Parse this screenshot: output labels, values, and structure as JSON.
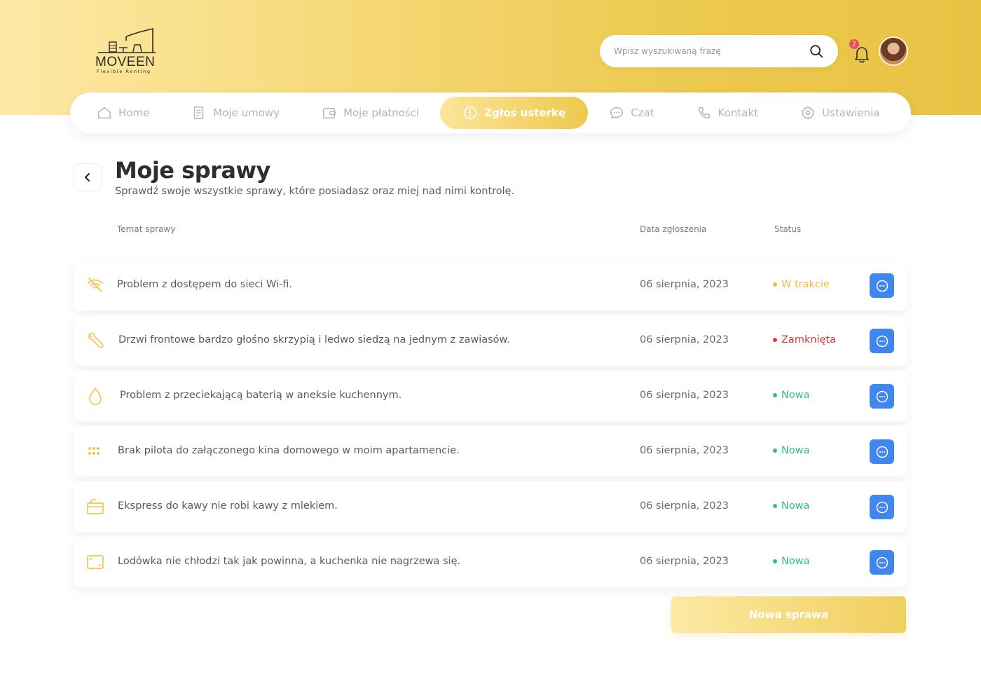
{
  "brand": {
    "name": "MOVEEN",
    "tagline": "Flexible Renting"
  },
  "search": {
    "placeholder": "Wpisz wyszukiwaną frazę"
  },
  "notifications": {
    "count": "2"
  },
  "nav": {
    "items": [
      {
        "label": "Home",
        "icon": "home-icon"
      },
      {
        "label": "Moje umowy",
        "icon": "document-icon"
      },
      {
        "label": "Moje płatności",
        "icon": "wallet-icon"
      },
      {
        "label": "Zgłoś usterkę",
        "icon": "alert-icon",
        "active": true
      },
      {
        "label": "Czat",
        "icon": "chat-icon"
      },
      {
        "label": "Kontakt",
        "icon": "phone-icon"
      },
      {
        "label": "Ustawienia",
        "icon": "gear-icon"
      }
    ]
  },
  "page": {
    "title": "Moje sprawy",
    "subtitle": "Sprawdź swoje wszystkie sprawy, które posiadasz oraz miej nad nimi kontrolę."
  },
  "table": {
    "headers": {
      "subject": "Temat sprawy",
      "date": "Data zgłoszenia",
      "status": "Status"
    },
    "rows": [
      {
        "icon": "wifi-off-icon",
        "subject": "Problem z dostępem do sieci Wi-fi.",
        "date": "06 sierpnia, 2023",
        "status": "W trakcie",
        "status_color": "#f4b73f"
      },
      {
        "icon": "wrench-icon",
        "subject": "Drzwi frontowe bardzo głośno skrzypią i ledwo siedzą na jednym z zawiasów.",
        "date": "06 sierpnia, 2023",
        "status": "Zamknięta",
        "status_color": "#e8343b"
      },
      {
        "icon": "water-drop-icon",
        "subject": "Problem z przeciekającą baterią w aneksie kuchennym.",
        "date": "06 sierpnia, 2023",
        "status": "Nowa",
        "status_color": "#2fbf7e"
      },
      {
        "icon": "remote-icon",
        "subject": "Brak pilota do załączonego kina domowego w moim apartamencie.",
        "date": "06 sierpnia, 2023",
        "status": "Nowa",
        "status_color": "#2fbf7e"
      },
      {
        "icon": "coffee-machine-icon",
        "subject": "Ekspress do kawy nie robi kawy z mlekiem.",
        "date": "06 sierpnia, 2023",
        "status": "Nowa",
        "status_color": "#2fbf7e"
      },
      {
        "icon": "fridge-icon",
        "subject": "Lodówka nie chłodzi tak jak powinna, a kuchenka nie nagrzewa się.",
        "date": "06 sierpnia, 2023",
        "status": "Nowa",
        "status_color": "#2fbf7e"
      }
    ]
  },
  "actions": {
    "new_case": "Nowa sprawa"
  },
  "colors": {
    "accent": "#eec94c",
    "chat_button": "#3f86ef"
  }
}
